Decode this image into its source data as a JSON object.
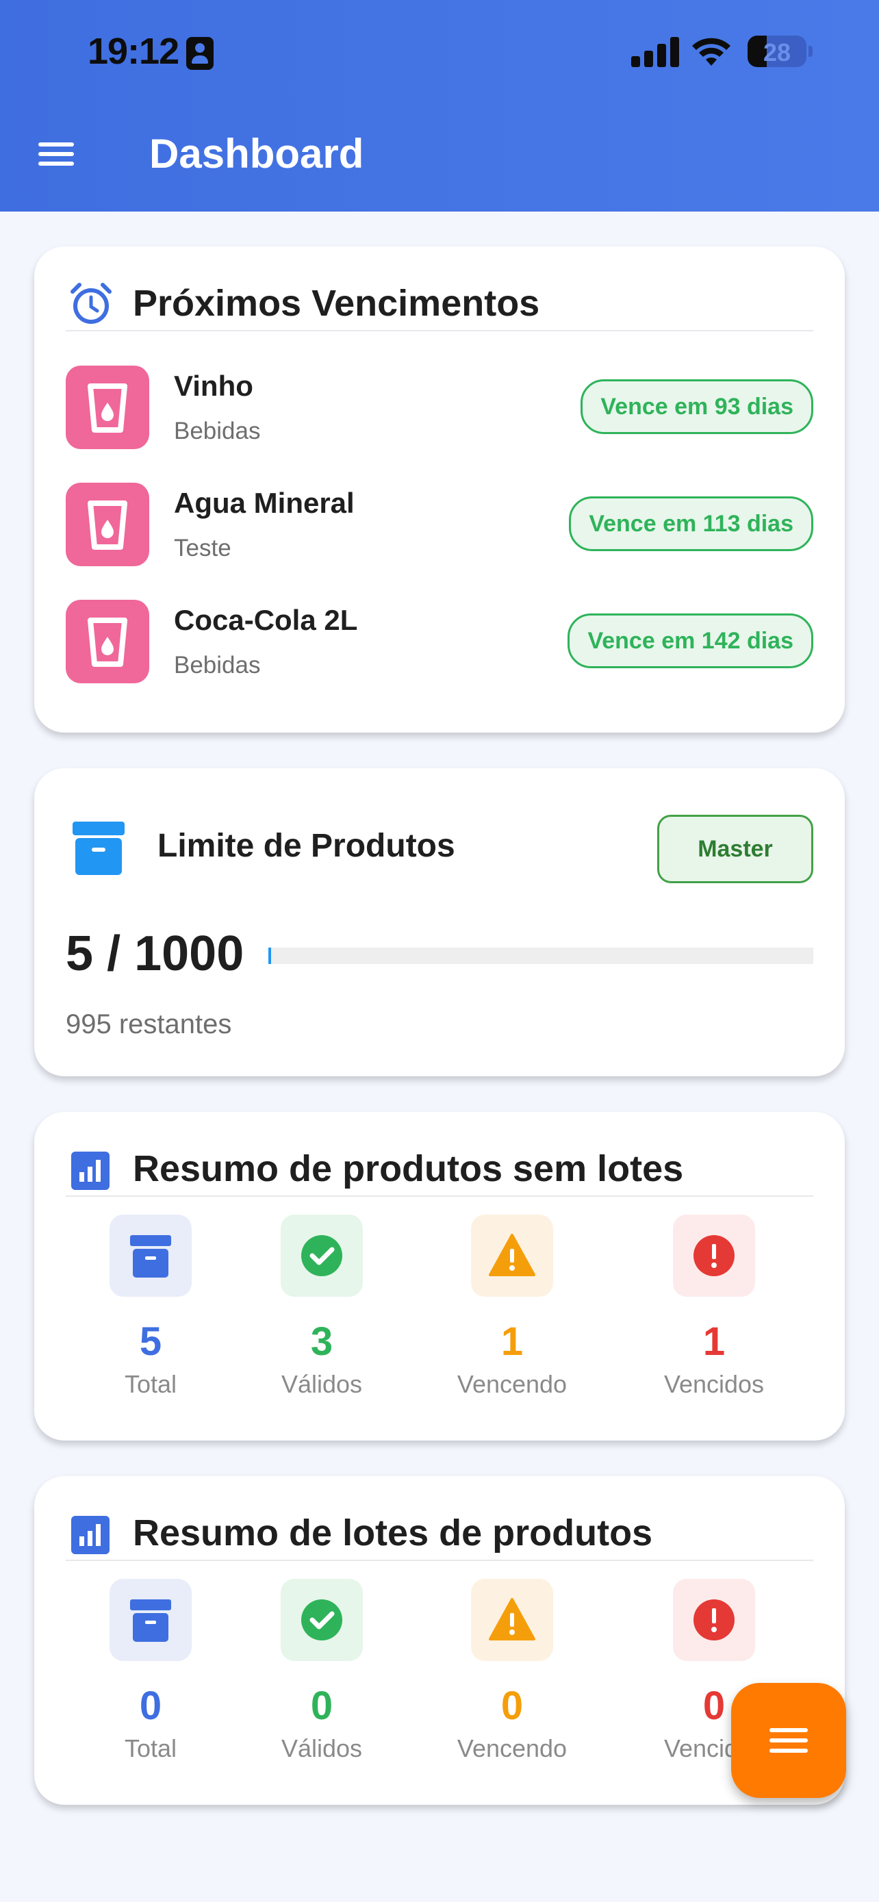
{
  "status_bar": {
    "time": "19:12",
    "battery": "28"
  },
  "app_bar": {
    "title": "Dashboard"
  },
  "upcoming": {
    "title": "Próximos Vencimentos",
    "items": [
      {
        "name": "Vinho",
        "category": "Bebidas",
        "badge": "Vence em 93 dias"
      },
      {
        "name": "Agua Mineral",
        "category": "Teste",
        "badge": "Vence em 113 dias"
      },
      {
        "name": "Coca-Cola 2L",
        "category": "Bebidas",
        "badge": "Vence em 142 dias"
      }
    ]
  },
  "limit": {
    "title": "Limite de Produtos",
    "plan": "Master",
    "used": "5",
    "separator": "/",
    "max": "1000",
    "used_fraction": 0.005,
    "remaining": "995 restantes"
  },
  "summary_products": {
    "title": "Resumo de produtos sem lotes",
    "stats": [
      {
        "value": "5",
        "label": "Total",
        "color": "#3f6ee0"
      },
      {
        "value": "3",
        "label": "Válidos",
        "color": "#2fb35a"
      },
      {
        "value": "1",
        "label": "Vencendo",
        "color": "#f59e0b"
      },
      {
        "value": "1",
        "label": "Vencidos",
        "color": "#e53935"
      }
    ]
  },
  "summary_batches": {
    "title": "Resumo de lotes de produtos",
    "stats": [
      {
        "value": "0",
        "label": "Total",
        "color": "#3f6ee0"
      },
      {
        "value": "0",
        "label": "Válidos",
        "color": "#2fb35a"
      },
      {
        "value": "0",
        "label": "Vencendo",
        "color": "#f59e0b"
      },
      {
        "value": "0",
        "label": "Vencidos",
        "color": "#e53935"
      }
    ]
  },
  "icons": {
    "menu": "menu-icon",
    "alarm": "alarm-clock-icon",
    "product": "cup-drop-icon",
    "archive": "archive-box-icon",
    "chart": "bar-chart-icon",
    "valid": "check-circle-icon",
    "warning": "warning-triangle-icon",
    "error": "error-circle-icon",
    "fab": "menu-icon"
  }
}
